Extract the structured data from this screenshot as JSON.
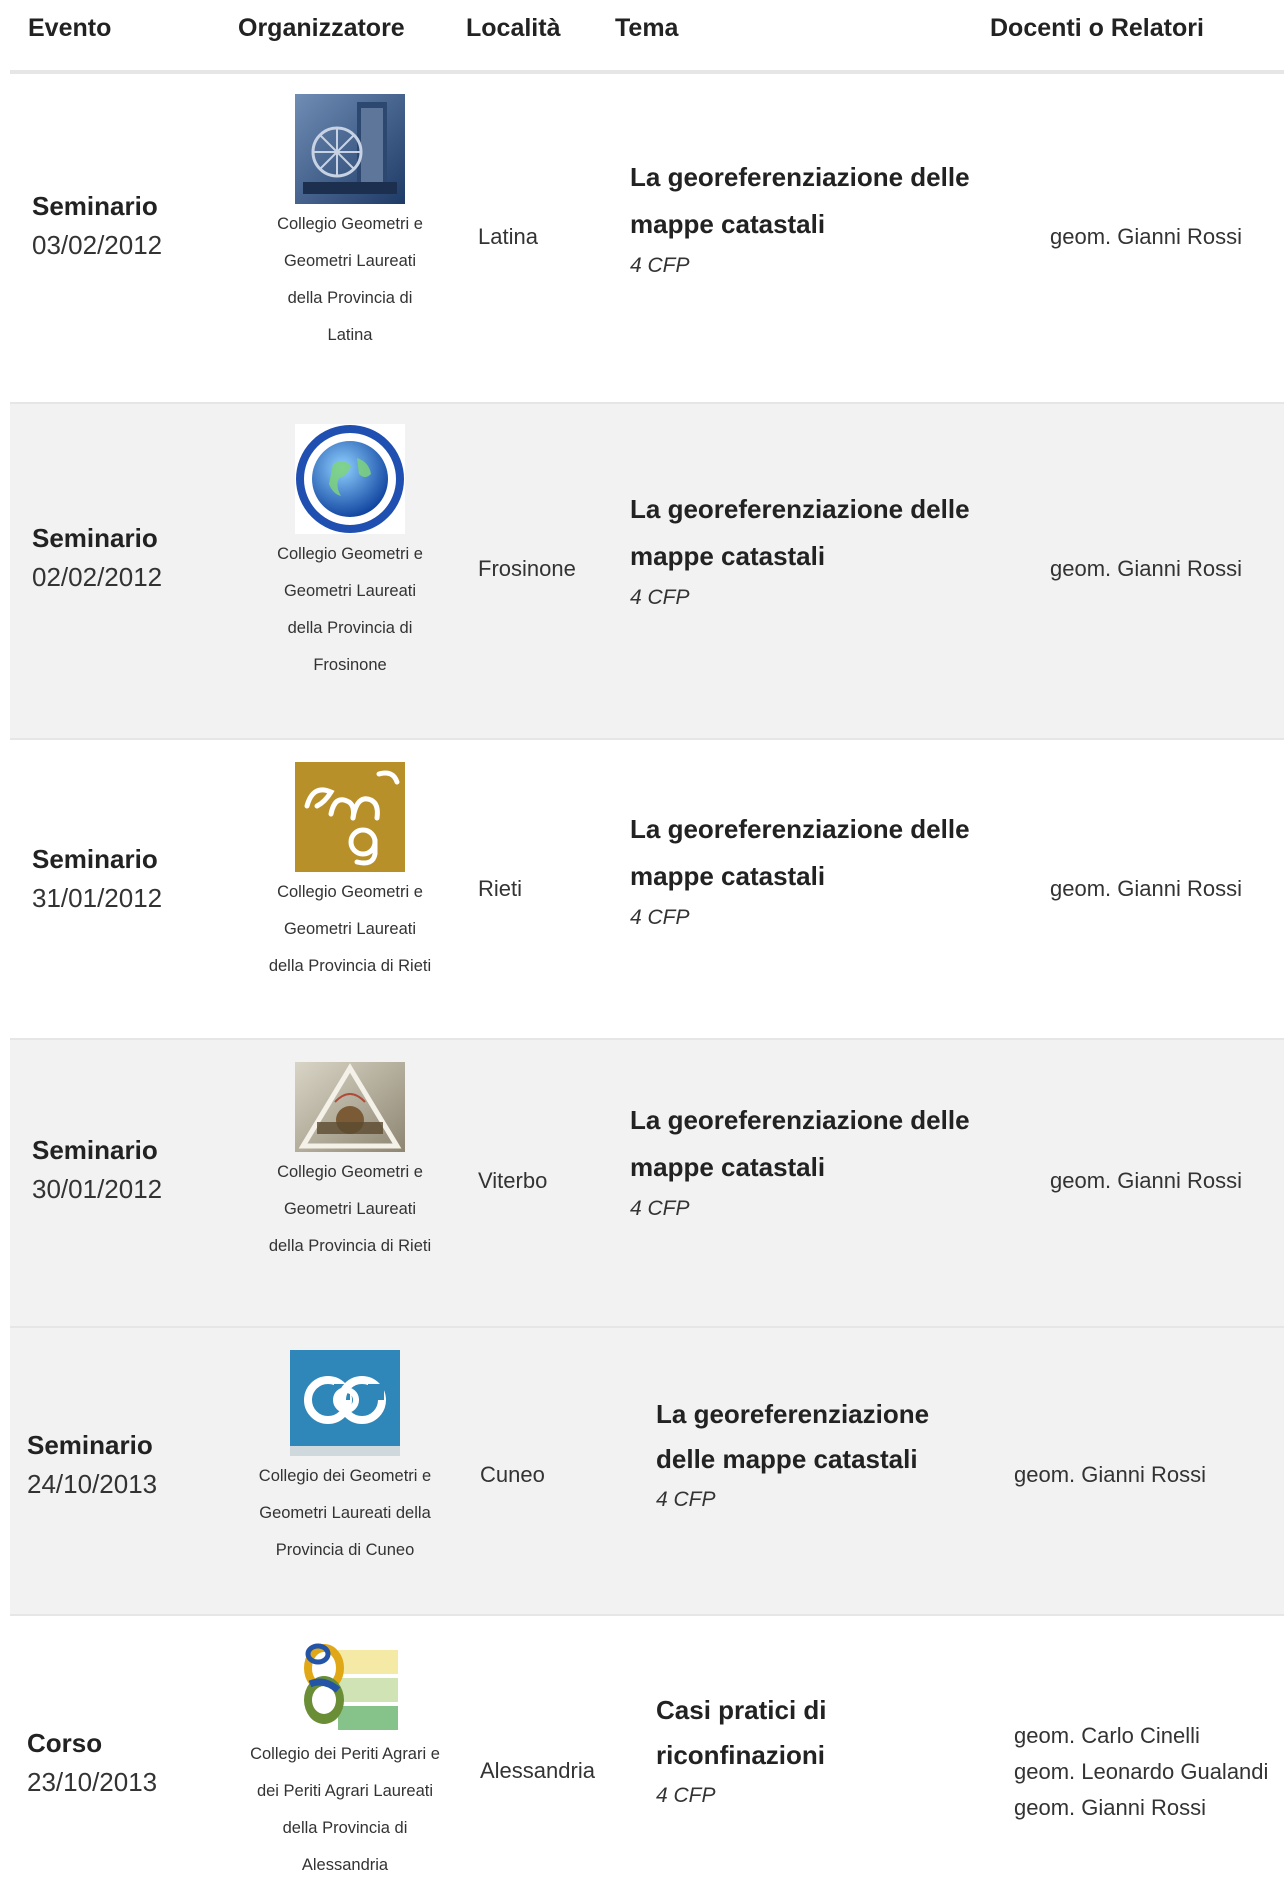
{
  "headers": {
    "evento": "Evento",
    "organizzatore": "Organizzatore",
    "localita": "Località",
    "tema": "Tema",
    "docenti": "Docenti o Relatori"
  },
  "rows": [
    {
      "type": "Seminario",
      "date": "03/02/2012",
      "organizer": [
        "Collegio Geometri e",
        "Geometri Laureati",
        "della Provincia di",
        "Latina"
      ],
      "logo_icon": "building-logo-icon",
      "location": "Latina",
      "tema": [
        "La georeferenziazione delle",
        "mappe catastali"
      ],
      "cfp": "4 CFP",
      "docenti": [
        "geom. Gianni Rossi"
      ]
    },
    {
      "type": "Seminario",
      "date": "02/02/2012",
      "organizer": [
        "Collegio Geometri e",
        "Geometri Laureati",
        "della Provincia di",
        "Frosinone"
      ],
      "logo_icon": "globe-logo-icon",
      "location": "Frosinone",
      "tema": [
        "La georeferenziazione delle",
        "mappe catastali"
      ],
      "cfp": "4 CFP",
      "docenti": [
        "geom. Gianni Rossi"
      ]
    },
    {
      "type": "Seminario",
      "date": "31/01/2012",
      "organizer": [
        "Collegio Geometri e",
        "Geometri Laureati",
        "della Provincia di Rieti"
      ],
      "logo_icon": "cng-logo-icon",
      "location": "Rieti",
      "tema": [
        "La georeferenziazione delle",
        "mappe catastali"
      ],
      "cfp": "4 CFP",
      "docenti": [
        "geom. Gianni Rossi"
      ]
    },
    {
      "type": "Seminario",
      "date": "30/01/2012",
      "organizer": [
        "Collegio Geometri e",
        "Geometri Laureati",
        "della Provincia di Rieti"
      ],
      "logo_icon": "geometri-triangle-logo-icon",
      "location": "Viterbo",
      "tema": [
        "La georeferenziazione delle",
        "mappe catastali"
      ],
      "cfp": "4 CFP",
      "docenti": [
        "geom. Gianni Rossi"
      ]
    },
    {
      "type": "Seminario",
      "date": "24/10/2013",
      "organizer": [
        "Collegio dei Geometri e",
        "Geometri Laureati della",
        "Provincia di Cuneo"
      ],
      "logo_icon": "cgc-logo-icon",
      "location": "Cuneo",
      "tema": [
        "La georeferenziazione",
        "delle mappe catastali"
      ],
      "cfp": "4 CFP",
      "docenti": [
        "geom. Gianni Rossi"
      ]
    },
    {
      "type": "Corso",
      "date": "23/10/2013",
      "organizer": [
        "Collegio dei Periti Agrari e",
        "dei Periti Agrari Laureati",
        "della Provincia di",
        "Alessandria"
      ],
      "logo_icon": "periti-agrari-logo-icon",
      "location": "Alessandria",
      "tema": [
        "Casi pratici di",
        "riconfinazioni"
      ],
      "cfp": "4 CFP",
      "docenti": [
        "geom. Carlo Cinelli",
        "geom. Leonardo Gualandi",
        "geom. Gianni Rossi"
      ]
    }
  ]
}
